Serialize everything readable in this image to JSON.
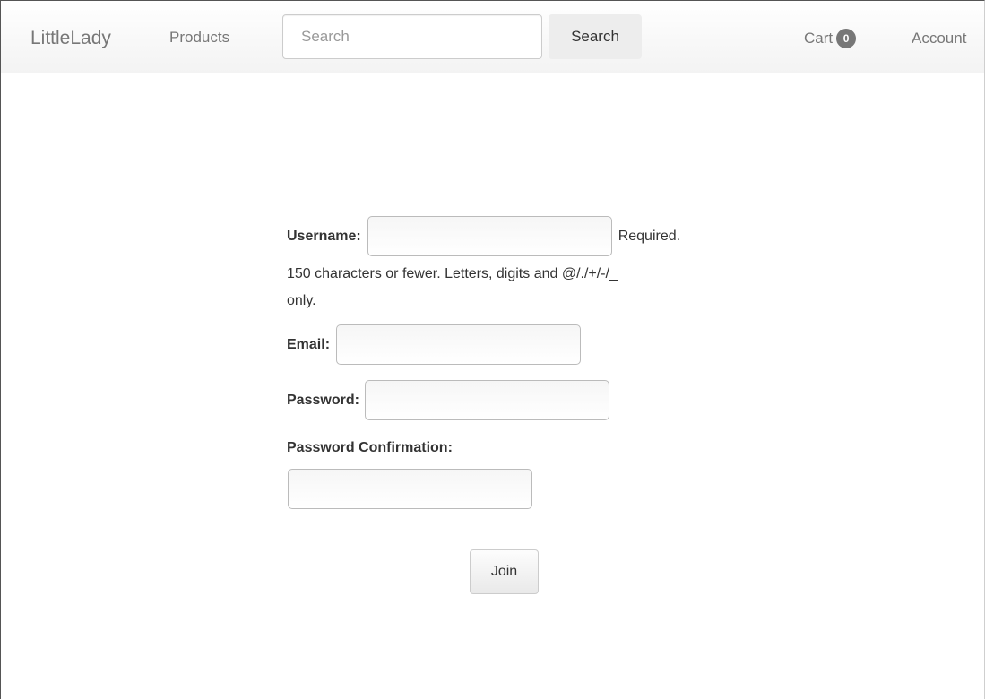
{
  "navbar": {
    "brand": "LittleLady",
    "products_label": "Products",
    "search_placeholder": "Search",
    "search_button": "Search",
    "cart_label": "Cart",
    "cart_count": "0",
    "account_label": "Account"
  },
  "form": {
    "username_label": "Username:",
    "username_value": "",
    "username_required": "Required.",
    "username_help_line1": "150 characters or fewer. Letters, digits and @/./+/-/_",
    "username_help_line2": "only.",
    "email_label": "Email:",
    "email_value": "",
    "password_label": "Password:",
    "password_value": "",
    "password_confirm_label": "Password Confirmation:",
    "password_confirm_value": "",
    "join_button": "Join"
  },
  "colors": {
    "nav_text": "#777777",
    "badge_bg": "#777777",
    "body_text": "#333333",
    "button_bg": "#ededed"
  },
  "icons": {}
}
